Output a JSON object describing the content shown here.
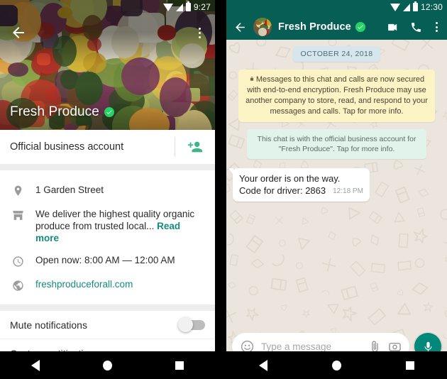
{
  "left": {
    "statusbar": {
      "time": "9:27"
    },
    "profile": {
      "name": "Fresh Produce",
      "verified_badge": "verified-check-icon",
      "back_icon": "back-arrow-icon",
      "menu_icon": "overflow-menu-icon"
    },
    "business_row": {
      "label": "Official business account",
      "add_icon": "add-person-icon"
    },
    "details": [
      {
        "icon": "location-pin-icon",
        "text": "1 Garden Street",
        "link": false
      },
      {
        "icon": "storefront-icon",
        "text": "We deliver the highest quality organic produce from trusted local...",
        "readmore": "Read more",
        "link": false
      },
      {
        "icon": "clock-icon",
        "text": "Open now: 8:00 AM — 12:00 AM",
        "link": false
      },
      {
        "icon": "globe-icon",
        "text": "freshproduceforall.com",
        "link": true
      }
    ],
    "notifications": [
      {
        "label": "Mute notifications",
        "toggle": "off"
      },
      {
        "label": "Custom notitications",
        "toggle": null
      }
    ]
  },
  "right": {
    "statusbar": {
      "time": "12:30"
    },
    "header": {
      "name": "Fresh Produce",
      "back_icon": "back-arrow-icon",
      "avatar": "contact-avatar",
      "verified_badge": "verified-check-icon",
      "video_icon": "video-call-icon",
      "call_icon": "phone-call-icon",
      "menu_icon": "overflow-menu-icon"
    },
    "date_chip": "OCTOBER 24, 2018",
    "encryption_notice": "Messages to this chat and calls are now secured with end-to-end encryption. Fresh Produce may use another company to store, read, and respond to your messages and calls. Tap for more info.",
    "business_notice": "This chat is with the official business account for \"Fresh Produce\". Tap for more info.",
    "messages": [
      {
        "line1": "Your order is on the way.",
        "line2": "Code for driver: 2863",
        "time": "12:18 PM"
      }
    ],
    "composer": {
      "placeholder": "Type a message",
      "emoji_icon": "emoji-smiley-icon",
      "attach_icon": "paperclip-icon",
      "camera_icon": "camera-icon",
      "mic_icon": "microphone-icon"
    }
  },
  "navbar": {
    "back": "nav-back-icon",
    "home": "nav-home-icon",
    "recents": "nav-recents-icon"
  },
  "colors": {
    "header_teal": "#075E54",
    "accent_teal": "#128C7E",
    "verified_green": "#25D366",
    "chat_bg": "#ECE5DD",
    "encryption_yellow": "#FDF4C5",
    "business_green": "#E2F3EB",
    "date_chip_blue": "#D7E5EC",
    "mic_teal": "#00897B"
  }
}
